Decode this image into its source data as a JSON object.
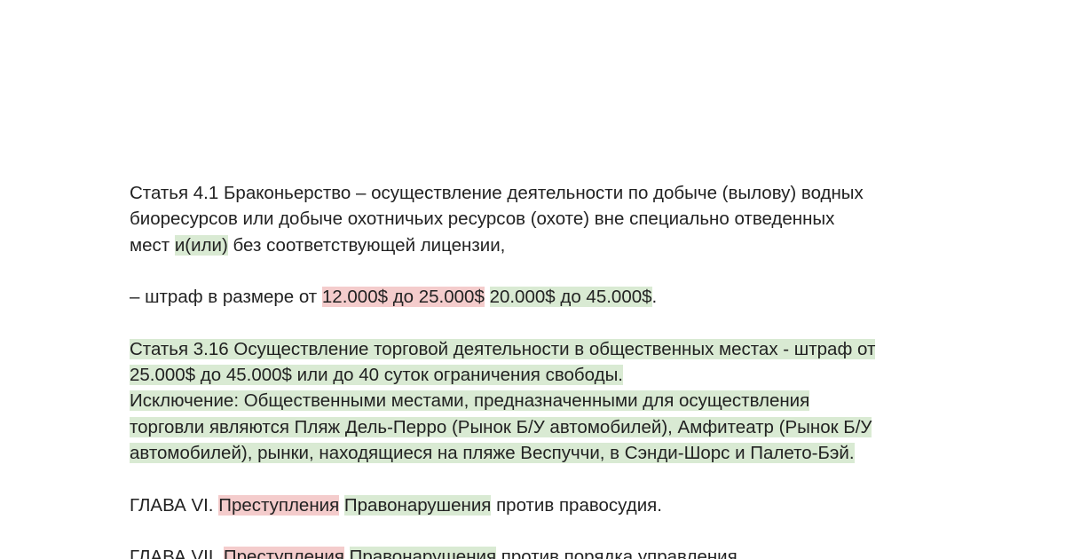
{
  "colors": {
    "text": "#222222",
    "added_highlight": "#d9ead3",
    "removed_highlight": "#f4cccc"
  },
  "article_4_1": {
    "line1": "Статья 4.1 Браконьерство – осуществление деятельности по добыче (вылову) водных",
    "line2": "биоресурсов или добыче охотничьих ресурсов (охоте) вне специально отведенных",
    "line3_start": "мест ",
    "line3_added": "и(или)",
    "line3_end": " без соответствующей лицензии,"
  },
  "fine": {
    "prefix": "– штраф в размере от ",
    "old_amount": "12.000$ до 25.000$",
    "new_amount": "20.000$ до 45.000$",
    "suffix": "."
  },
  "article_3_16": {
    "line1": "Статья 3.16 Осуществление торговой деятельности в общественных местах - штраф от",
    "line2": "25.000$ до 45.000$ или до 40 суток ограничения свободы.",
    "exception_line1": "Исключение: Общественными местами, предназначенными для осуществления",
    "exception_line2": "торговли являются Пляж Дель-Перро (Рынок Б/У автомобилей), Амфитеатр (Рынок Б/У",
    "exception_line3": "автомобилей), рынки, находящиеся на пляже Веспуччи, в Сэнди-Шорс и Палето-Бэй."
  },
  "chapter_6": {
    "prefix": "ГЛАВА VI. ",
    "old_word": "Преступления",
    "new_word": "Правонарушения",
    "suffix": " против правосудия."
  },
  "chapter_7": {
    "prefix": "ГЛАВА VII. ",
    "old_word": "Преступления",
    "new_word": "Правонарушения",
    "suffix": " против порядка управления."
  }
}
